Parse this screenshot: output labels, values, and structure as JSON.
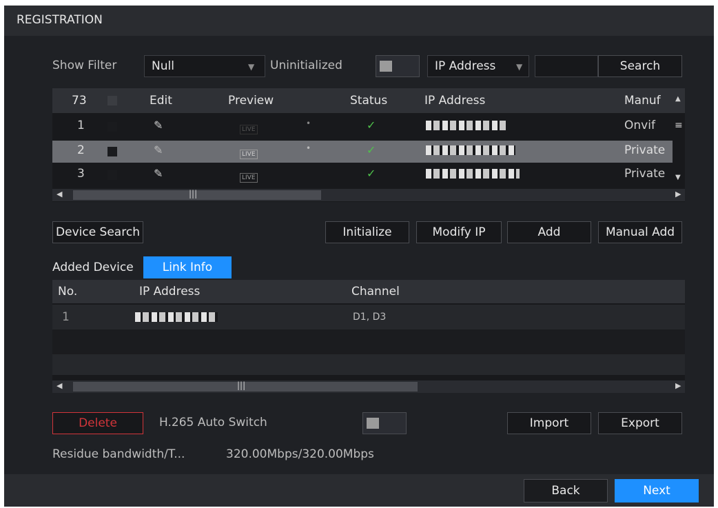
{
  "window": {
    "title": "REGISTRATION"
  },
  "filter": {
    "show_filter_label": "Show Filter",
    "show_filter_value": "Null",
    "uninitialized_label": "Uninitialized",
    "search_type_value": "IP Address",
    "search_text": "",
    "search_button": "Search"
  },
  "device_table": {
    "count": "73",
    "headers": {
      "edit": "Edit",
      "preview": "Preview",
      "status": "Status",
      "ip": "IP Address",
      "manufacturer": "Manuf"
    },
    "rows": [
      {
        "no": "1",
        "manufacturer": "Onvif",
        "live": "LIVE"
      },
      {
        "no": "2",
        "manufacturer": "Private",
        "live": "LIVE"
      },
      {
        "no": "3",
        "manufacturer": "Private",
        "live": "LIVE"
      }
    ]
  },
  "actions": {
    "device_search": "Device Search",
    "initialize": "Initialize",
    "modify_ip": "Modify IP",
    "add": "Add",
    "manual_add": "Manual Add"
  },
  "tabs": {
    "added_device": "Added Device",
    "link_info": "Link Info"
  },
  "link_table": {
    "headers": {
      "no": "No.",
      "ip": "IP Address",
      "channel": "Channel"
    },
    "rows": [
      {
        "no": "1",
        "channel": "D1, D3"
      }
    ]
  },
  "bottom": {
    "delete": "Delete",
    "h265_label": "H.265 Auto Switch",
    "import": "Import",
    "export": "Export",
    "residue_label": "Residue bandwidth/T...",
    "residue_value": "320.00Mbps/320.00Mbps"
  },
  "footer": {
    "back": "Back",
    "next": "Next"
  },
  "colors": {
    "accent": "#1e90ff",
    "delete_border": "#d2353a",
    "status_ok": "#4fc14b"
  }
}
